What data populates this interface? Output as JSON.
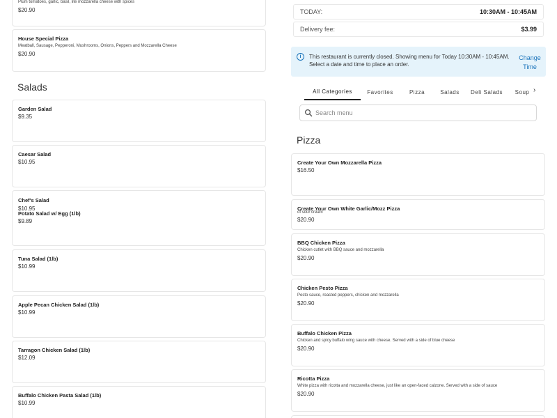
{
  "left": {
    "top_partial": {
      "desc": "Plum tomatoes, garlic, basil, lite mozzarella cheese with spices",
      "price": "$20.90"
    },
    "house_special": {
      "name": "House Special Pizza",
      "desc": "Meatball, Sausage, Pepperoni, Mushrooms, Onions, Peppers and Mozzarella Cheese",
      "price": "$20.90"
    },
    "salads_title": "Salads",
    "salads": [
      {
        "name": "Garden Salad",
        "price": "$9.35"
      },
      {
        "name": "Caesar Salad",
        "price": "$10.95"
      },
      {
        "name": "Chef's Salad",
        "price": "$10.95"
      },
      {
        "name": "Potato Salad w/ Egg (1lb)",
        "price": "$9.89"
      },
      {
        "name": "Tuna Salad (1lb)",
        "price": "$10.99"
      },
      {
        "name": "Apple Pecan Chicken Salad (1lb)",
        "price": "$10.99"
      },
      {
        "name": "Tarragon Chicken Salad (1lb)",
        "price": "$12.09"
      },
      {
        "name": "Buffalo Chicken Pasta Salad (1lb)",
        "price": "$10.99"
      }
    ]
  },
  "info": {
    "today_label": "TODAY:",
    "today_value": "10:30AM - 10:45AM",
    "fee_label": "Delivery fee:",
    "fee_value": "$3.99"
  },
  "alert": {
    "text": "This restaurant is currently closed. Showing menu for Today 10:30AM - 10:45AM. Select a date and time to place an order.",
    "link_line1": "Change",
    "link_line2": "Time"
  },
  "tabs": [
    "All Categories",
    "Favorites",
    "Pizza",
    "Salads",
    "Deli Salads",
    "Soup"
  ],
  "search": {
    "placeholder": "Search menu",
    "value": ""
  },
  "pizza": {
    "title": "Pizza",
    "items": [
      {
        "name": "Create Your Own Mozzarella Pizza",
        "desc": "",
        "price": "$16.50"
      },
      {
        "name": "Create Your Own White Garlic/Mozz Pizza",
        "desc": "of sour cream",
        "price": "$20.90"
      },
      {
        "name": "BBQ Chicken Pizza",
        "desc": "Chicken cutlet with BBQ sauce and mozzarella",
        "price": "$20.90"
      },
      {
        "name": "Chicken Pesto Pizza",
        "desc": "Pesto sauce, roasted peppers, chicken and mozzarella",
        "price": "$20.90"
      },
      {
        "name": "Buffalo Chicken Pizza",
        "desc": "Chicken and spicy buffalo wing sauce with cheese. Served with a side of blue cheese",
        "price": "$20.90"
      },
      {
        "name": "Ricotta Pizza",
        "desc": "White pizza with ricotta and mozzarella cheese, just like an open-faced calzone. Served with a side of sauce",
        "price": "$20.90"
      }
    ]
  }
}
